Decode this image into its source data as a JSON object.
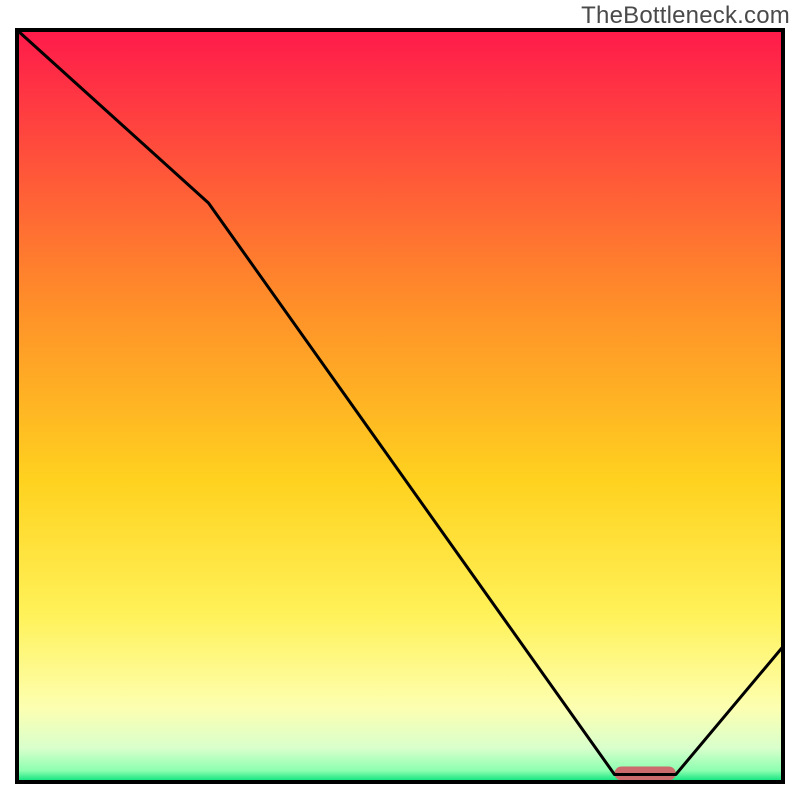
{
  "watermark": "TheBottleneck.com",
  "chart_data": {
    "type": "line",
    "title": "",
    "xlabel": "",
    "ylabel": "",
    "xlim": [
      0,
      100
    ],
    "ylim": [
      0,
      100
    ],
    "x": [
      0,
      25,
      78,
      86,
      100
    ],
    "values": [
      100,
      77,
      1,
      1,
      18
    ],
    "marker": {
      "x_range": [
        78,
        86
      ],
      "y": 1,
      "color": "#cc6b6b"
    },
    "gradient_stops": [
      {
        "offset": 0.0,
        "color": "#ff1a4b"
      },
      {
        "offset": 0.35,
        "color": "#ff8a2a"
      },
      {
        "offset": 0.6,
        "color": "#ffd21f"
      },
      {
        "offset": 0.78,
        "color": "#fff25a"
      },
      {
        "offset": 0.9,
        "color": "#fdffb0"
      },
      {
        "offset": 0.955,
        "color": "#d9ffcc"
      },
      {
        "offset": 0.985,
        "color": "#8cffb0"
      },
      {
        "offset": 1.0,
        "color": "#00e07a"
      }
    ],
    "line_color": "#000000",
    "frame_color": "#000000",
    "background": "#ffffff"
  }
}
